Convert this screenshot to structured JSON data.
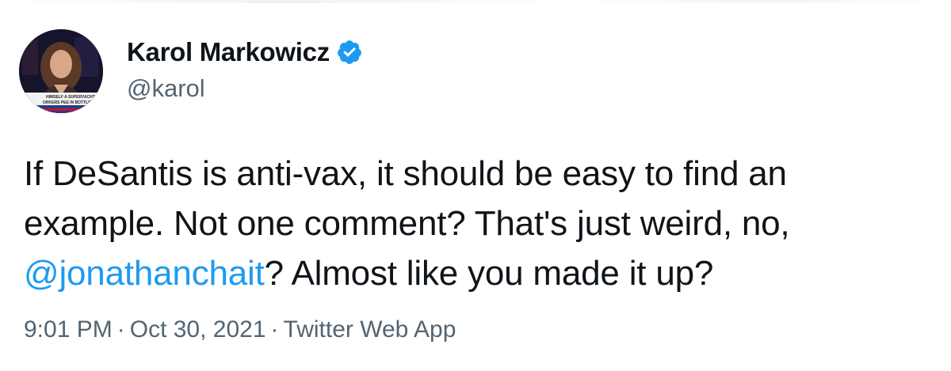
{
  "author": {
    "display_name": "Karol Markowicz",
    "handle": "@karol",
    "verified_icon": "verified-badge-icon",
    "avatar_chyron_line1": "HIMSELF A SUPERYACHT",
    "avatar_chyron_line2": "ORKERS PEE IN BOTTLE"
  },
  "tweet": {
    "line1": "If DeSantis is anti-vax, it should be easy to find an",
    "line2": "example. Not one comment? That's just weird, no,",
    "mention": "@jonathanchait",
    "line3_rest": "? Almost like you made it up?"
  },
  "meta": {
    "time": "9:01 PM",
    "date": "Oct 30, 2021",
    "source": "Twitter Web App",
    "separator": "·"
  },
  "colors": {
    "accent": "#1d9bf0",
    "text": "#0f1419",
    "secondary": "#536471"
  }
}
